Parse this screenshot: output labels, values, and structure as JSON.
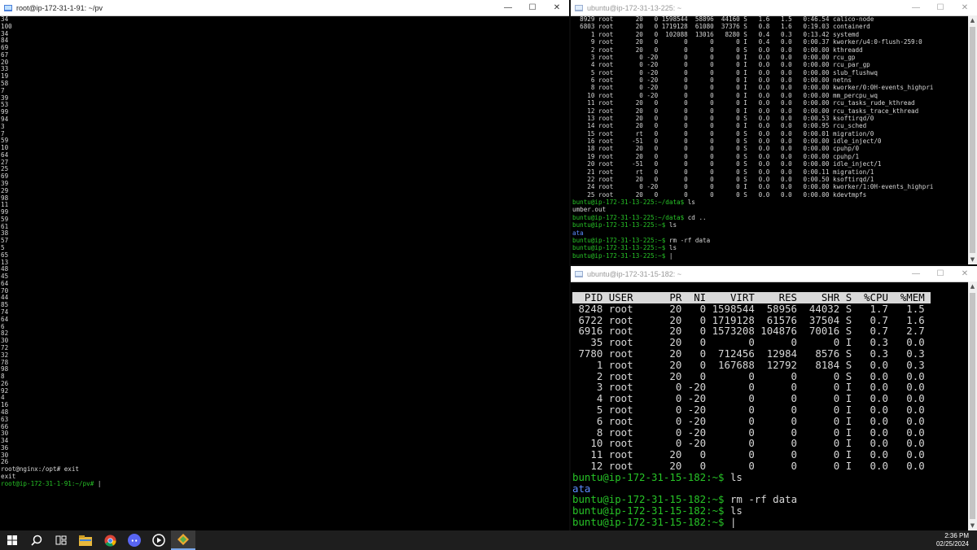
{
  "left_window": {
    "title": "root@ip-172-31-1-91: ~/pv",
    "lines": [
      "34",
      "100",
      "34",
      "84",
      "69",
      "67",
      "20",
      "33",
      "19",
      "58",
      "7",
      "39",
      "53",
      "99",
      "94",
      "3",
      "7",
      "59",
      "10",
      "64",
      "27",
      "25",
      "69",
      "39",
      "29",
      "98",
      "11",
      "99",
      "59",
      "61",
      "38",
      "57",
      "5",
      "65",
      "13",
      "48",
      "45",
      "64",
      "70",
      "44",
      "85",
      "74",
      "64",
      "6",
      "82",
      "30",
      "72",
      "32",
      "78",
      "98",
      "8",
      "26",
      "92",
      "4",
      "16",
      "48",
      "63",
      "66",
      "30",
      "34",
      "36",
      "30",
      "26"
    ],
    "cmd1": "root@nginx:/opt# exit",
    "cmd2": "exit",
    "prompt": "root@ip-172-31-1-91:~/pv# "
  },
  "right_top_window": {
    "title": "ubuntu@ip-172-31-13-225: ~",
    "rows": [
      "  8929 root      20   0 1598544  58896  44160 S   1.6   1.5   0:46.54 calico-node",
      "  6803 root      20   0 1719128  61080  37376 S   0.8   1.6   0:19.03 containerd",
      "     1 root      20   0  102088  13016   8280 S   0.4   0.3   0:13.42 systemd",
      "     9 root      20   0       0      0      0 I   0.4   0.0   0:00.37 kworker/u4:0-flush-259:0",
      "     2 root      20   0       0      0      0 S   0.0   0.0   0:00.00 kthreadd",
      "     3 root       0 -20       0      0      0 I   0.0   0.0   0:00.00 rcu_gp",
      "     4 root       0 -20       0      0      0 I   0.0   0.0   0:00.00 rcu_par_gp",
      "     5 root       0 -20       0      0      0 I   0.0   0.0   0:00.00 slub_flushwq",
      "     6 root       0 -20       0      0      0 I   0.0   0.0   0:00.00 netns",
      "     8 root       0 -20       0      0      0 I   0.0   0.0   0:00.00 kworker/0:0H-events_highpri",
      "    10 root       0 -20       0      0      0 I   0.0   0.0   0:00.00 mm_percpu_wq",
      "    11 root      20   0       0      0      0 I   0.0   0.0   0:00.00 rcu_tasks_rude_kthread",
      "    12 root      20   0       0      0      0 I   0.0   0.0   0:00.00 rcu_tasks_trace_kthread",
      "    13 root      20   0       0      0      0 S   0.0   0.0   0:00.53 ksoftirqd/0",
      "    14 root      20   0       0      0      0 I   0.0   0.0   0:00.95 rcu_sched",
      "    15 root      rt   0       0      0      0 S   0.0   0.0   0:00.01 migration/0",
      "    16 root     -51   0       0      0      0 S   0.0   0.0   0:00.00 idle_inject/0",
      "    18 root      20   0       0      0      0 S   0.0   0.0   0:00.00 cpuhp/0",
      "    19 root      20   0       0      0      0 S   0.0   0.0   0:00.00 cpuhp/1",
      "    20 root     -51   0       0      0      0 S   0.0   0.0   0:00.00 idle_inject/1",
      "    21 root      rt   0       0      0      0 S   0.0   0.0   0:00.11 migration/1",
      "    22 root      20   0       0      0      0 S   0.0   0.0   0:00.50 ksoftirqd/1",
      "    24 root       0 -20       0      0      0 I   0.0   0.0   0:00.00 kworker/1:0H-events_highpri",
      "    25 root      20   0       0      0      0 S   0.0   0.0   0:00.00 kdevtmpfs"
    ],
    "p1": "buntu@ip-172-31-13-225:~/data$ ",
    "c1": "ls",
    "out1": "umber.out",
    "p2": "buntu@ip-172-31-13-225:~/data$ ",
    "c2": "cd ..",
    "p3": "buntu@ip-172-31-13-225:~$ ",
    "c3": "ls",
    "out2": "ata",
    "p4": "buntu@ip-172-31-13-225:~$ ",
    "c4": "rm -rf data",
    "p5": "buntu@ip-172-31-13-225:~$ ",
    "c5": "ls",
    "p6": "buntu@ip-172-31-13-225:~$ "
  },
  "right_bottom_window": {
    "title": "ubuntu@ip-172-31-15-182: ~",
    "header": "  PID USER      PR  NI    VIRT    RES    SHR S  %CPU  %MEM ",
    "rows": [
      " 8248 root      20   0 1598544  58956  44032 S   1.7   1.5",
      " 6722 root      20   0 1719128  61576  37504 S   0.7   1.6",
      " 6916 root      20   0 1573208 104876  70016 S   0.7   2.7",
      "   35 root      20   0       0      0      0 I   0.3   0.0",
      " 7780 root      20   0  712456  12984   8576 S   0.3   0.3",
      "    1 root      20   0  167688  12792   8184 S   0.0   0.3",
      "    2 root      20   0       0      0      0 S   0.0   0.0",
      "    3 root       0 -20       0      0      0 I   0.0   0.0",
      "    4 root       0 -20       0      0      0 I   0.0   0.0",
      "    5 root       0 -20       0      0      0 I   0.0   0.0",
      "    6 root       0 -20       0      0      0 I   0.0   0.0",
      "    8 root       0 -20       0      0      0 I   0.0   0.0",
      "   10 root       0 -20       0      0      0 I   0.0   0.0",
      "   11 root      20   0       0      0      0 I   0.0   0.0",
      "   12 root      20   0       0      0      0 I   0.0   0.0"
    ],
    "p1": "buntu@ip-172-31-15-182:~$ ",
    "c1": "ls",
    "out1": "ata",
    "p2": "buntu@ip-172-31-15-182:~$ ",
    "c2": "rm -rf data",
    "p3": "buntu@ip-172-31-15-182:~$ ",
    "c3": "ls",
    "p4": "buntu@ip-172-31-15-182:~$ "
  },
  "window_controls": {
    "minimize": "—",
    "maximize": "☐",
    "close": "✕"
  },
  "taskbar": {
    "time": "2:36 PM",
    "date": "02/25/2024"
  },
  "colors": {
    "prompt_green": "#27c427",
    "dir_blue": "#5b8cff",
    "header_bg": "#d9d9d9"
  }
}
